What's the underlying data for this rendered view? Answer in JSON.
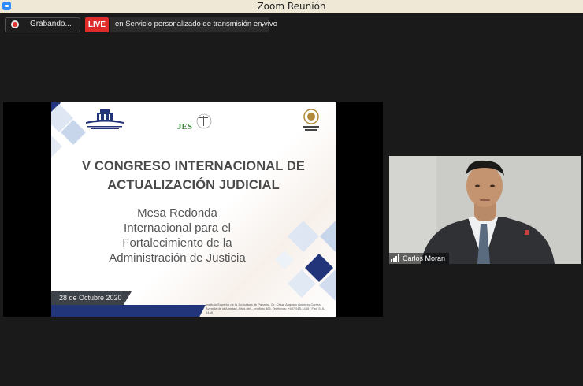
{
  "window": {
    "title": "Zoom Reunión"
  },
  "toolbar": {
    "recording_label": "Grabando...",
    "live_label": "LIVE",
    "live_service_label": "en Servicio personalizado de transmisión en vivo"
  },
  "slide": {
    "title_line1": "V CONGRESO INTERNACIONAL DE",
    "title_line2": "ACTUALIZACIÓN JUDICIAL",
    "subtitle_lines": [
      "Mesa Redonda",
      "Internacional para el",
      "Fortalecimiento de la",
      "Administración de Justicia"
    ],
    "date": "28 de Octubre 2020",
    "logos": {
      "left": "ISJUP",
      "center": "JES",
      "right": "ÓRGANO JUDICIAL"
    },
    "footer_text": "Instituto Superior de la Judicatura de Panamá, Dr. César Augusto Quintero Correa. Avenida de la Amistad, Altos del..., edificio 865, Teléfonos: +507 515-1445 / Fax: 515-1448"
  },
  "participant": {
    "name": "Carlos Moran"
  },
  "colors": {
    "live_red": "#e02b2b",
    "slide_navy": "#23357a",
    "background": "#1a1a1a"
  }
}
